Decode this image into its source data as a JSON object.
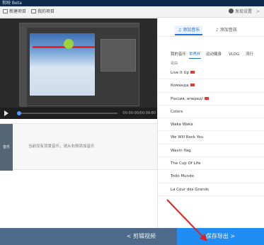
{
  "titlebar": {
    "title": "剪映 Beta"
  },
  "toolbar": {
    "new_project": "新建项目",
    "my_projects": "我的项目",
    "right_text": "发现设置",
    "chevron": ">"
  },
  "left": {
    "time": "00:00:00/00:09:80",
    "audio_label": "音乐",
    "audio_hint": "当前没有背景音乐，请从右侧添加音乐"
  },
  "right": {
    "tabs": [
      "添加音乐",
      "添加音效"
    ],
    "categories": [
      "我的音乐",
      "世界杯",
      "运动健身",
      "VLOG",
      "流行"
    ],
    "list_header": "歌曲",
    "songs": [
      {
        "name": "Live It Up",
        "flag": true
      },
      {
        "name": "Команда",
        "flag": true
      },
      {
        "name": "Россия, вперед!",
        "flag": true
      },
      {
        "name": "Colors",
        "flag": false
      },
      {
        "name": "Waka Waka",
        "flag": false
      },
      {
        "name": "We Will Rock You",
        "flag": false
      },
      {
        "name": "Wavin flag",
        "flag": false
      },
      {
        "name": "The Cup Of Life",
        "flag": false
      },
      {
        "name": "Todo Mundo",
        "flag": false
      },
      {
        "name": "La Cour des Grands",
        "flag": false
      }
    ]
  },
  "bottom": {
    "prev_label": "< 剪辑视频",
    "export_label": "保存导出 >"
  },
  "colors": {
    "accent": "#1f8df3",
    "dark": "#4d6a8a",
    "flag": "#e53935"
  },
  "icons": [
    "play-icon",
    "new-project-icon",
    "my-projects-icon",
    "settings-icon"
  ]
}
